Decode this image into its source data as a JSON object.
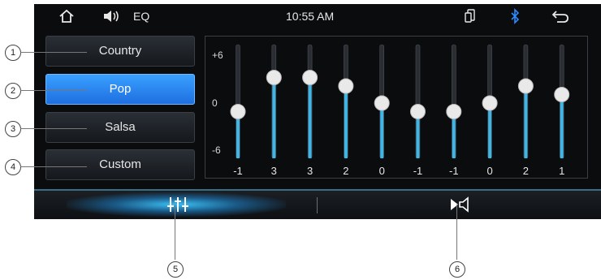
{
  "status": {
    "title": "EQ",
    "time": "10:55 AM"
  },
  "presets": [
    {
      "label": "Country",
      "active": false
    },
    {
      "label": "Pop",
      "active": true
    },
    {
      "label": "Salsa",
      "active": false
    },
    {
      "label": "Custom",
      "active": false
    }
  ],
  "scale": {
    "top": "+6",
    "mid": "0",
    "bottom": "-6"
  },
  "bands": [
    {
      "value": "-1",
      "level": -1
    },
    {
      "value": "3",
      "level": 3
    },
    {
      "value": "3",
      "level": 3
    },
    {
      "value": "2",
      "level": 2
    },
    {
      "value": "0",
      "level": 0
    },
    {
      "value": "-1",
      "level": -1
    },
    {
      "value": "-1",
      "level": -1
    },
    {
      "value": "0",
      "level": 0
    },
    {
      "value": "2",
      "level": 2
    },
    {
      "value": "1",
      "level": 1
    }
  ],
  "callouts": [
    "1",
    "2",
    "3",
    "4",
    "5",
    "6"
  ],
  "icons": {
    "home": "home-icon",
    "speaker": "speaker-icon",
    "phone": "phone-mirror-icon",
    "bluetooth": "bluetooth-icon",
    "back": "back-icon",
    "eq": "equalizer-icon",
    "balance": "speaker-balance-icon"
  },
  "colors": {
    "accent": "#1e6fe0",
    "slider": "#3fb6e6"
  }
}
